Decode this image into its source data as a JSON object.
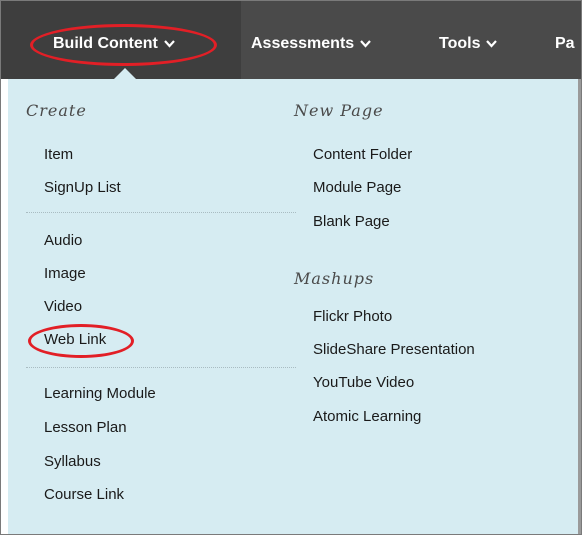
{
  "toolbar": {
    "build_content": "Build Content",
    "assessments": "Assessments",
    "tools": "Tools",
    "more": "Pa"
  },
  "menu": {
    "create_heading": "Create",
    "create_group1": [
      "Item",
      "SignUp List"
    ],
    "create_group2": [
      "Audio",
      "Image",
      "Video",
      "Web Link"
    ],
    "create_group3": [
      "Learning Module",
      "Lesson Plan",
      "Syllabus",
      "Course Link"
    ],
    "new_page_heading": "New Page",
    "new_page_items": [
      "Content Folder",
      "Module Page",
      "Blank Page"
    ],
    "mashups_heading": "Mashups",
    "mashups_items": [
      "Flickr Photo",
      "SlideShare Presentation",
      "YouTube Video",
      "Atomic Learning"
    ]
  },
  "colors": {
    "toolbar_bg": "#4a4a4a",
    "menu_bg": "#d6ecf2",
    "highlight": "#e21f26"
  }
}
